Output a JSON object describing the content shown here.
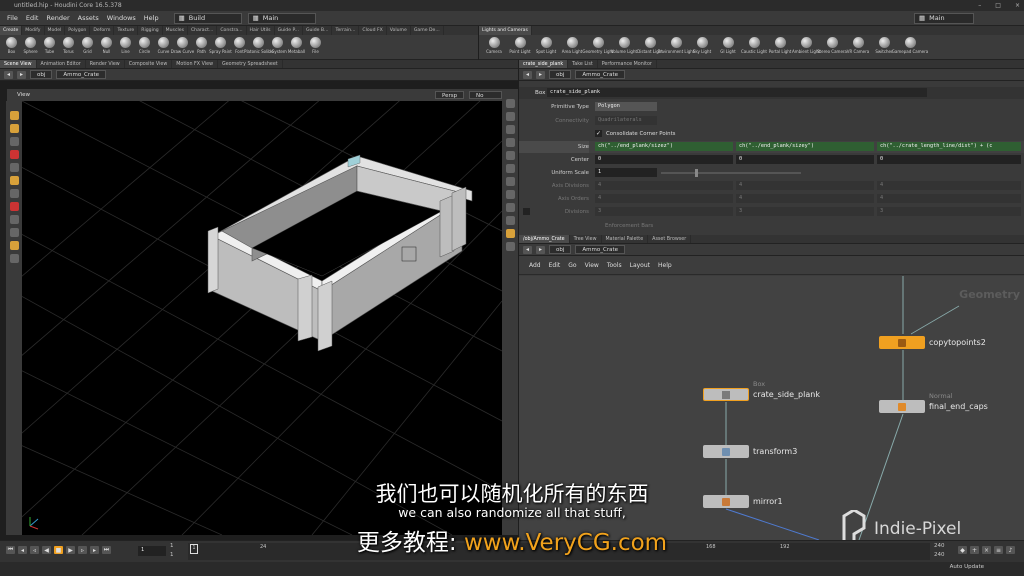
{
  "window": {
    "title": "untitled.hip - Houdini Core 16.5.378",
    "controls": [
      "–",
      "□",
      "×"
    ]
  },
  "menubar": {
    "items": [
      "File",
      "Edit",
      "Render",
      "Assets",
      "Windows",
      "Help"
    ],
    "build_desk": "Build",
    "main_desk": "Main",
    "right_desk": "Main"
  },
  "shelf_left": {
    "tabs": [
      "Create",
      "Modify",
      "Model",
      "Polygon",
      "Deform",
      "Texture",
      "Rigging",
      "Muscles",
      "Charact...",
      "Constra...",
      "Hair Utils",
      "Guide P...",
      "Guide B...",
      "Terrain...",
      "Cloud FX",
      "Volume",
      "Game De..."
    ],
    "tools": [
      "Box",
      "Sphere",
      "Tube",
      "Torus",
      "Grid",
      "Null",
      "Line",
      "Circle",
      "Curve",
      "Draw Curve",
      "Path",
      "Spray Paint",
      "Font",
      "Platonic Solids",
      "L-System",
      "Metaball",
      "File"
    ]
  },
  "shelf_right": {
    "tabs": [
      "Lights and Cameras"
    ],
    "tools": [
      "Camera",
      "Point Light",
      "Spot Light",
      "Area Light",
      "Geometry Light",
      "Volume Light",
      "Distant Light",
      "Environment Light",
      "Sky Light",
      "GI Light",
      "Caustic Light",
      "Portal Light",
      "Ambient Light",
      "Stereo Camera",
      "VR Camera",
      "Switcher",
      "Gamepad Camera"
    ]
  },
  "left_pane": {
    "tabs": [
      "Scene View",
      "Animation Editor",
      "Render View",
      "Composite View",
      "Motion FX View",
      "Geometry Spreadsheet"
    ],
    "path_obj": "obj",
    "path_node": "Ammo_Crate",
    "view_label": "View",
    "persp": "Persp",
    "cam": "No cam"
  },
  "params": {
    "tabs": [
      "crate_side_plank",
      "Take List",
      "Performance Monitor"
    ],
    "path_obj": "obj",
    "path_node": "Ammo_Crate",
    "node_type": "Box",
    "node_name": "crate_side_plank",
    "primitive_type_label": "Primitive Type",
    "primitive_type_value": "Polygon",
    "connectivity_label": "Connectivity",
    "connectivity_value": "Quadrilaterals",
    "consolidate_label": "Consolidate Corner Points",
    "size_label": "Size",
    "size_x": "ch(\"../end_plank/sizez\")",
    "size_y": "ch(\"../end_plank/sizey\")",
    "size_z": "ch(\"../crate_length_line/dist\") + (c",
    "center_label": "Center",
    "center": [
      "0",
      "0",
      "0"
    ],
    "uniform_scale_label": "Uniform Scale",
    "uniform_scale_value": "1",
    "axis_divisions_label": "Axis Divisions",
    "axis_divisions": [
      "4",
      "4",
      "4"
    ],
    "axis_orders_label": "Axis Orders",
    "axis_orders": [
      "4",
      "4",
      "4"
    ],
    "divisions_label": "Divisions",
    "divisions": [
      "3",
      "3",
      "3"
    ],
    "enforcement_label": "Enforcement Bars"
  },
  "network": {
    "tabs": [
      "/obj/Ammo_Crate",
      "Tree View",
      "Material Palette",
      "Asset Browser"
    ],
    "path_obj": "obj",
    "path_node": "Ammo_Crate",
    "menu": [
      "Add",
      "Edit",
      "Go",
      "View",
      "Tools",
      "Layout",
      "Help"
    ],
    "context_label": "Geometry",
    "nodes": [
      {
        "name": "copytopoints2",
        "type": ""
      },
      {
        "name": "crate_side_plank",
        "type": "Box"
      },
      {
        "name": "final_end_caps",
        "type": "Normal"
      },
      {
        "name": "transform3",
        "type": ""
      },
      {
        "name": "mirror1",
        "type": ""
      }
    ]
  },
  "timeline": {
    "frame": "1",
    "start": "1",
    "start2": "1",
    "ticks": [
      "1",
      "24",
      "168",
      "192"
    ],
    "end": "240",
    "end2": "240",
    "auto_update": "Auto Update"
  },
  "subtitles": {
    "chinese": "我们也可以随机化所有的东西",
    "english": "we can also randomize all that stuff,",
    "promo_prefix": "更多教程: ",
    "promo_url": "www.VeryCG.com"
  },
  "watermark": "Indie-Pixel"
}
